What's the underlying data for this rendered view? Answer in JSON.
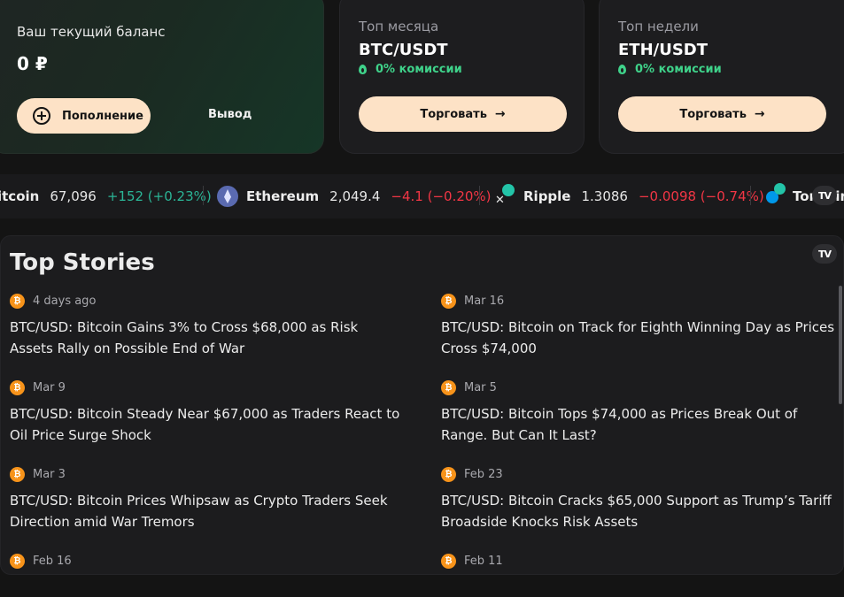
{
  "balance_card": {
    "label": "Ваш текущий баланс",
    "value": "0 ₽",
    "topup_label": "Пополнение",
    "withdraw_label": "Вывод"
  },
  "top_month": {
    "label": "Топ месяца",
    "pair": "BTC/USDT",
    "fee": "0% комиссии",
    "trade_label": "Торговать"
  },
  "top_week": {
    "label": "Топ недели",
    "pair": "ETH/USDT",
    "fee": "0% комиссии",
    "trade_label": "Торговать"
  },
  "ticker": {
    "items": [
      {
        "name": "itcoin",
        "price": "67,096",
        "change": "+152 (+0.23%)",
        "direction": "up"
      },
      {
        "name": "Ethereum",
        "price": "2,049.4",
        "change": "−4.1 (−0.20%)",
        "direction": "down"
      },
      {
        "name": "Ripple",
        "price": "1.3086",
        "change": "−0.0098 (−0.74%)",
        "direction": "down"
      },
      {
        "name": "Toncoin",
        "price": "",
        "change": "",
        "direction": ""
      }
    ],
    "logo": "TV"
  },
  "stories": {
    "title": "Top Stories",
    "logo": "TV",
    "items": [
      {
        "time": "4 days ago",
        "headline": "BTC/USD: Bitcoin Gains 3% to Cross $68,000 as Risk Assets Rally on Possible End of War"
      },
      {
        "time": "Mar 16",
        "headline": "BTC/USD: Bitcoin on Track for Eighth Winning Day as Prices Cross $74,000"
      },
      {
        "time": "Mar 9",
        "headline": "BTC/USD: Bitcoin Steady Near $67,000 as Traders React to Oil Price Surge Shock"
      },
      {
        "time": "Mar 5",
        "headline": "BTC/USD: Bitcoin Tops $74,000 as Prices Break Out of Range. But Can It Last?"
      },
      {
        "time": "Mar 3",
        "headline": "BTC/USD: Bitcoin Prices Whipsaw as Crypto Traders Seek Direction amid War Tremors"
      },
      {
        "time": "Feb 23",
        "headline": "BTC/USD: Bitcoin Cracks $65,000 Support as Trump’s Tariff Broadside Knocks Risk Assets"
      },
      {
        "time": "Feb 16",
        "headline": ""
      },
      {
        "time": "Feb 11",
        "headline": ""
      }
    ]
  },
  "colors": {
    "accent_button": "#fde2c6",
    "positive": "#2bb596",
    "negative": "#f23645",
    "fee_green": "#3fd28a",
    "bitcoin": "#f7931a"
  }
}
